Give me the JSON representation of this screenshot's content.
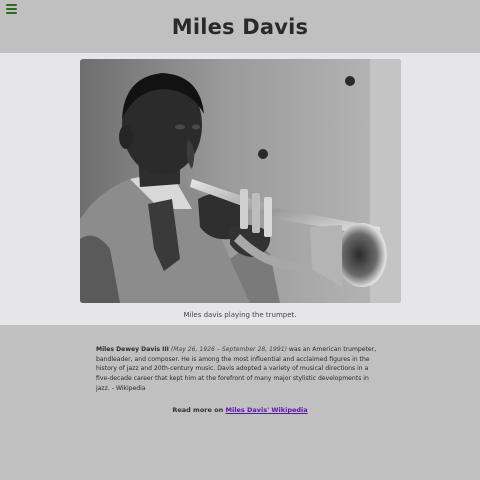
{
  "header": {
    "menu_icon": "hamburger-menu-icon",
    "menu_icon_color": "#2f6b1e",
    "title": "Miles Davis"
  },
  "figure": {
    "image_description": "Black and white photograph of a man playing a trumpet",
    "caption": "Miles davis playing the trumpet."
  },
  "bio": {
    "name": "Miles Dewey Davis III",
    "dates": "(May 26, 1926 – September 28, 1991)",
    "text": " was an American trumpeter, bandleader, and composer. He is among the most influential and acclaimed figures in the history of jazz and 20th-century music. Davis adopted a variety of musical directions in a five-decade career that kept him at the forefront of many major stylistic developments in jazz. - Wikipedia"
  },
  "read_more": {
    "prefix": "Read more on ",
    "link_text": "Miles Davis' Wikipedia",
    "link_color": "#5a16a8"
  },
  "colors": {
    "page_background": "#c0c0c0",
    "figure_band_background": "#e6e6ea"
  }
}
